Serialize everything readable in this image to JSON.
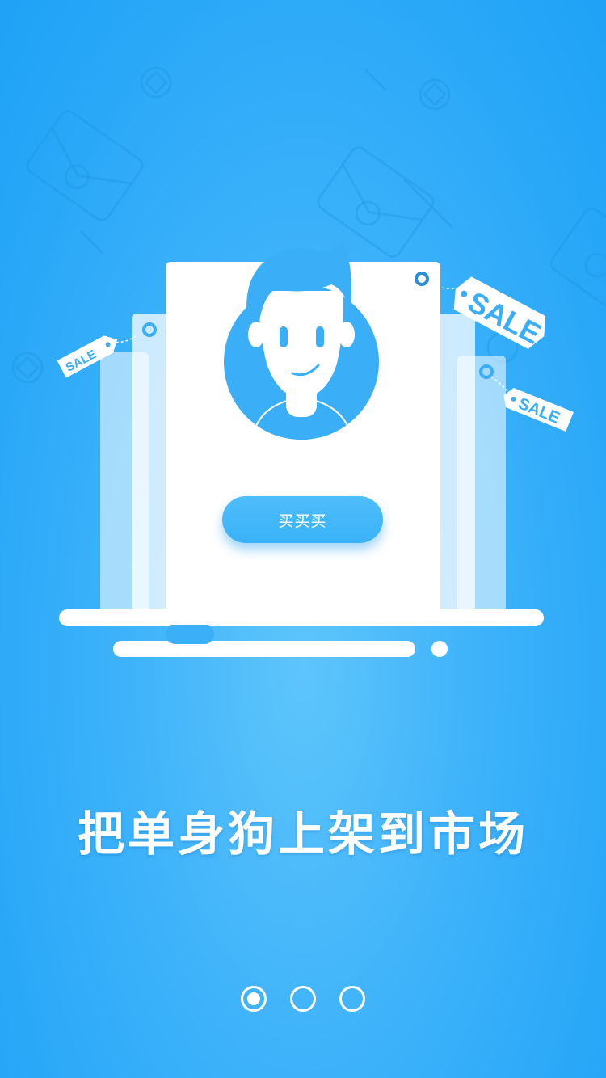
{
  "illustration": {
    "sale_tags": [
      "SALE",
      "SALE",
      "SALE"
    ]
  },
  "buy_button": {
    "label": "买买买"
  },
  "tagline": "把单身狗上架到市场",
  "pager": {
    "total": 3,
    "active_index": 0
  },
  "colors": {
    "background": "#2aa8f8",
    "accent": "#3ab2f8",
    "card": "#ffffff"
  }
}
